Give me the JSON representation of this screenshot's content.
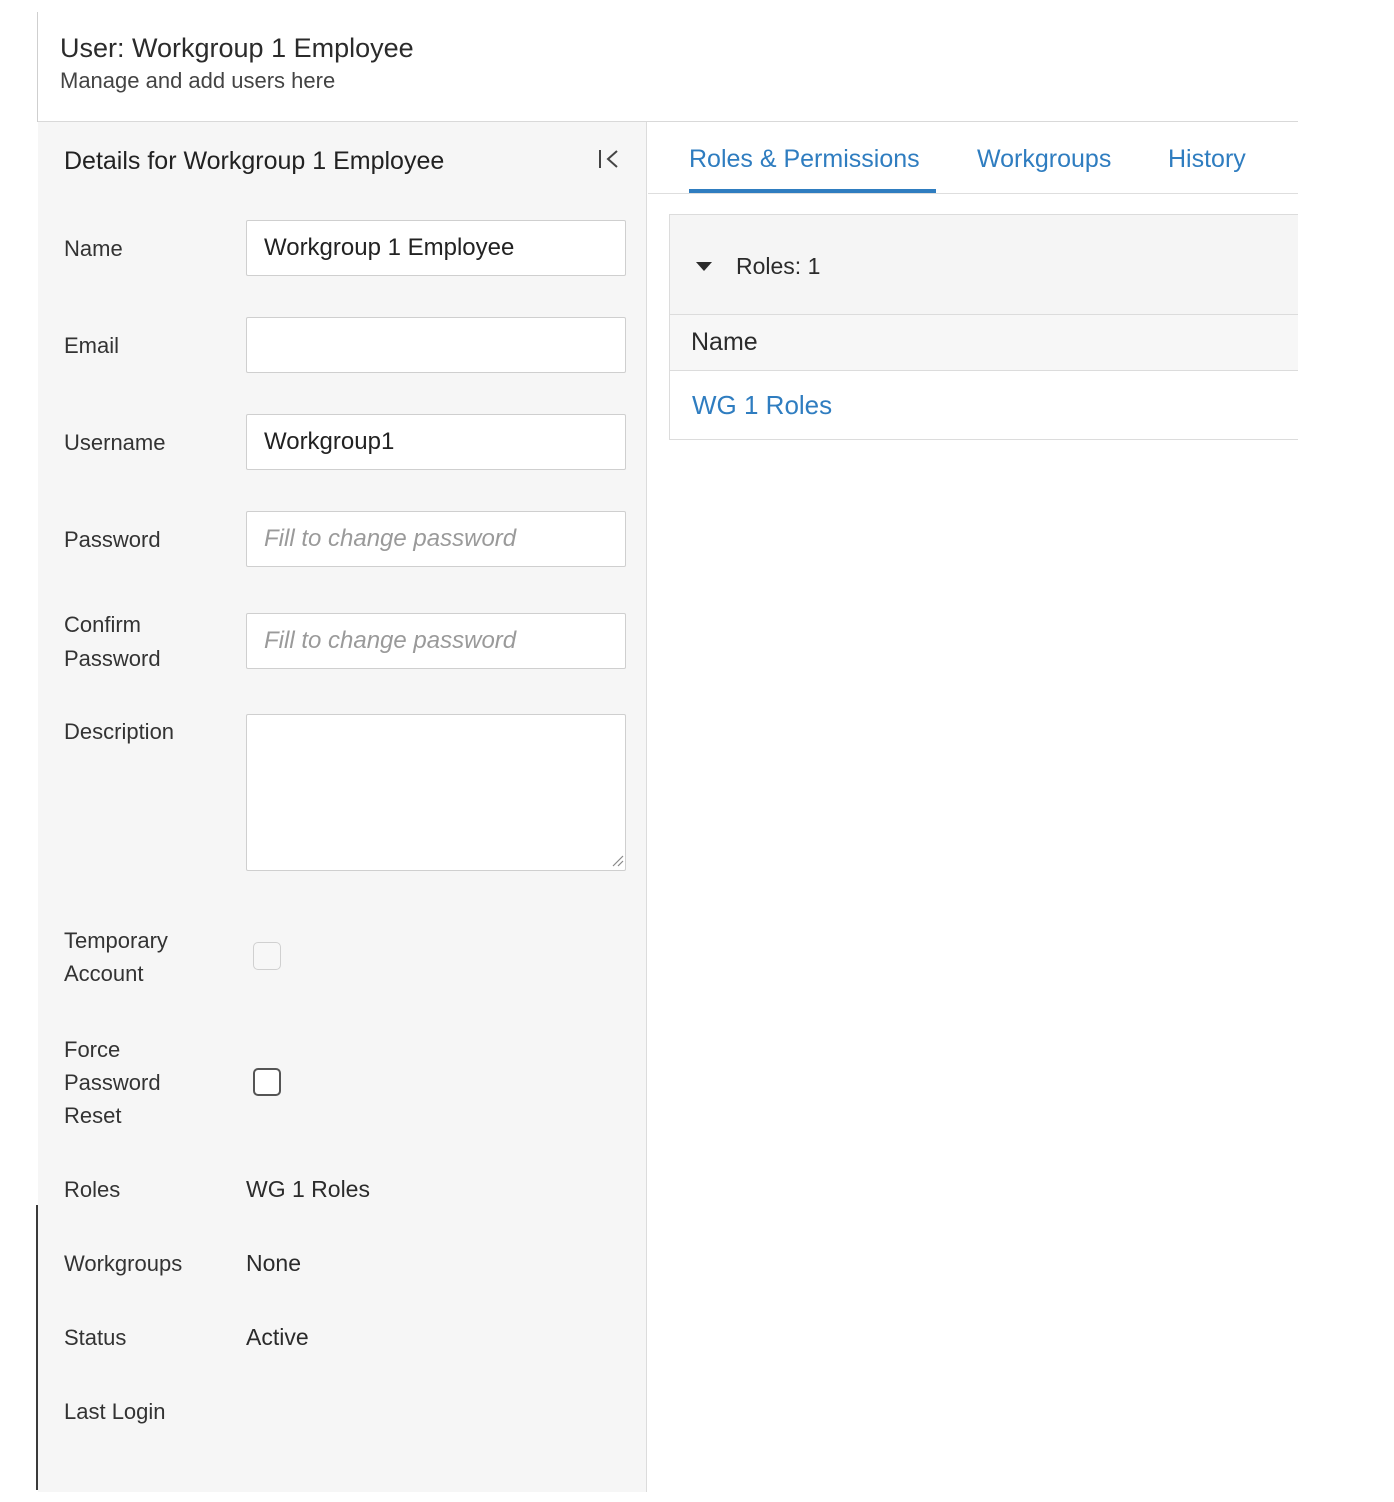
{
  "header": {
    "title": "User: Workgroup 1 Employee",
    "subtitle": "Manage and add users here"
  },
  "details": {
    "title": "Details for Workgroup 1 Employee",
    "collapse_icon": "collapse-left-icon",
    "fields": {
      "name": {
        "label": "Name",
        "value": "Workgroup 1 Employee"
      },
      "email": {
        "label": "Email",
        "value": ""
      },
      "username": {
        "label": "Username",
        "value": "Workgroup1"
      },
      "password": {
        "label": "Password",
        "placeholder": "Fill to change password"
      },
      "confirm_password": {
        "label_line1": "Confirm",
        "label_line2": "Password",
        "placeholder": "Fill to change password"
      },
      "description": {
        "label": "Description",
        "value": ""
      },
      "temporary_account": {
        "label_line1": "Temporary",
        "label_line2": "Account",
        "checked": false,
        "disabled": true
      },
      "force_password_reset": {
        "label_line1": "Force",
        "label_line2": "Password",
        "label_line3": "Reset",
        "checked": false
      },
      "roles": {
        "label": "Roles",
        "value": "WG 1 Roles"
      },
      "workgroups": {
        "label": "Workgroups",
        "value": "None"
      },
      "status": {
        "label": "Status",
        "value": "Active"
      },
      "last_login": {
        "label": "Last Login",
        "value": ""
      }
    }
  },
  "tabs": [
    {
      "label": "Roles & Permissions",
      "active": true
    },
    {
      "label": "Workgroups",
      "active": false
    },
    {
      "label": "History",
      "active": false
    }
  ],
  "roles_panel": {
    "count_label": "Roles: 1",
    "caret_icon": "caret-down-icon",
    "columns": [
      "Name"
    ],
    "rows": [
      {
        "name": "WG 1 Roles"
      }
    ]
  },
  "colors": {
    "link": "#2f7dc0",
    "panel_bg": "#f6f6f6",
    "border": "#dcdcdc"
  }
}
